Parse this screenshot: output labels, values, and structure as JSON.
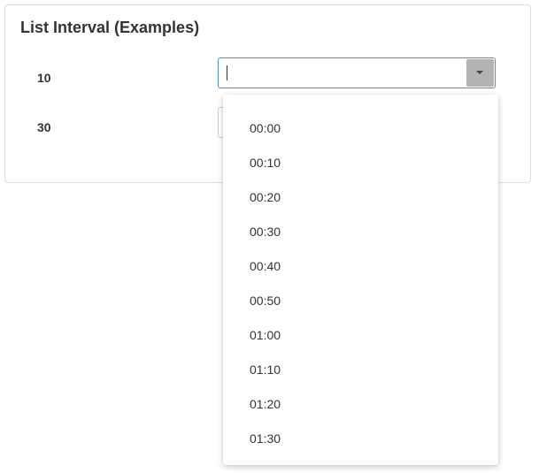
{
  "panel": {
    "title": "List Interval (Examples)"
  },
  "rows": [
    {
      "label": "10",
      "input_value": ""
    },
    {
      "label": "30",
      "input_value": ""
    }
  ],
  "dropdown": {
    "options": [
      "00:00",
      "00:10",
      "00:20",
      "00:30",
      "00:40",
      "00:50",
      "01:00",
      "01:10",
      "01:20",
      "01:30"
    ]
  },
  "icons": {
    "dropdown_toggle": "caret-down-icon"
  },
  "colors": {
    "focus_border": "#4a90c4",
    "toggle_bg": "#b3b3b3"
  }
}
